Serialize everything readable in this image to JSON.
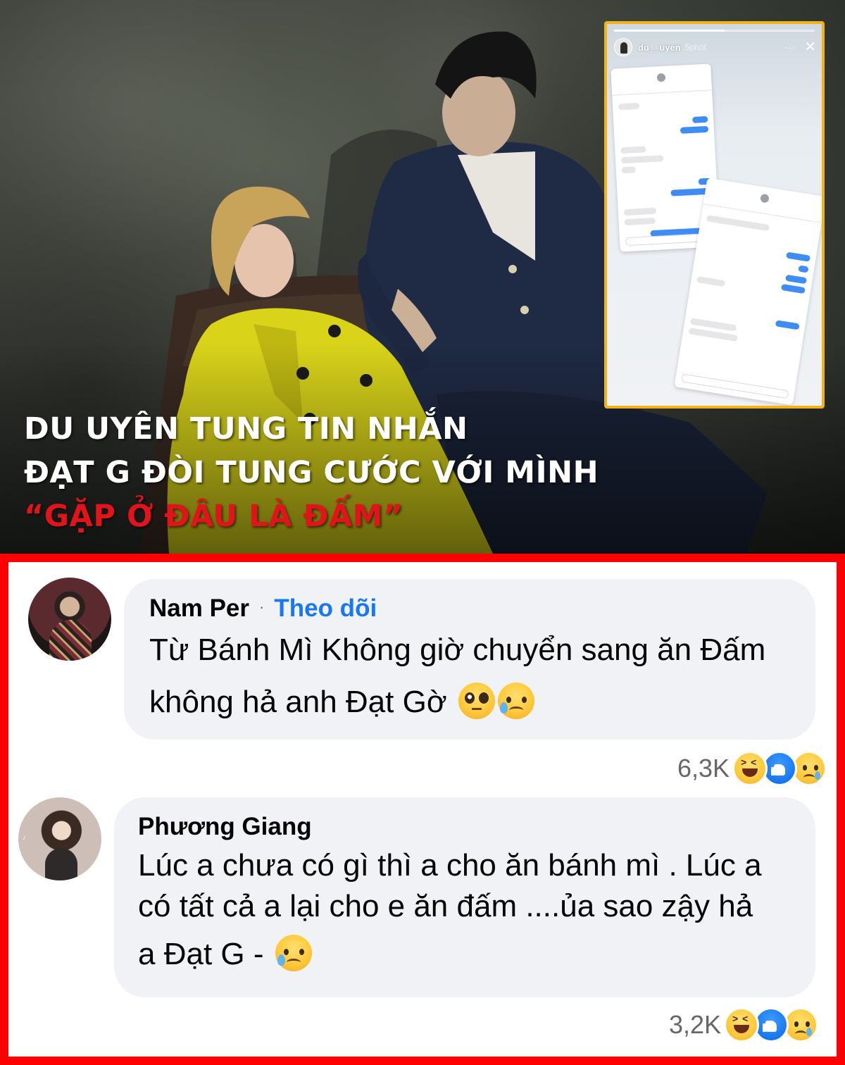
{
  "banner": {
    "headline": {
      "line1": "DU UYÊN TUNG TIN NHẮN",
      "line2": "ĐẠT G ĐÒI TUNG CƯỚC VỚI MÌNH",
      "line3": "“GẶP Ở ĐÂU LÀ ĐẤM”"
    },
    "headline_accent_color": "#e1141a",
    "inset_border_color": "#f1b21c"
  },
  "story": {
    "username": "du__uyen",
    "time": "5phút",
    "more_icon": "more-icon",
    "close_icon": "close-icon"
  },
  "comments": [
    {
      "author": "Nam Per",
      "separator": "·",
      "follow_label": "Theo dõi",
      "text_lines": [
        "Từ Bánh Mì Không giờ chuyển sang ăn Đấm",
        "không hả anh Đạt Gờ"
      ],
      "emojis": [
        "pleading-face-emoji",
        "sad-relieved-face-emoji"
      ],
      "reaction_count": "6,3K",
      "reactions": [
        "haha",
        "like",
        "sad"
      ]
    },
    {
      "author": "Phương Giang",
      "text_lines": [
        "Lúc a chưa có gì thì a cho ăn bánh mì . Lúc a",
        "có tất cả a lại cho e ăn đấm ....ủa sao zậy hả",
        "a Đạt G -"
      ],
      "emojis": [
        "crying-face-emoji"
      ],
      "reaction_count": "3,2K",
      "reactions": [
        "haha",
        "like",
        "sad"
      ]
    }
  ],
  "colors": {
    "panel_border": "#ff0000",
    "bubble_bg": "#f0f2f5",
    "follow_link": "#1877f2",
    "meta_text": "#65676b"
  }
}
